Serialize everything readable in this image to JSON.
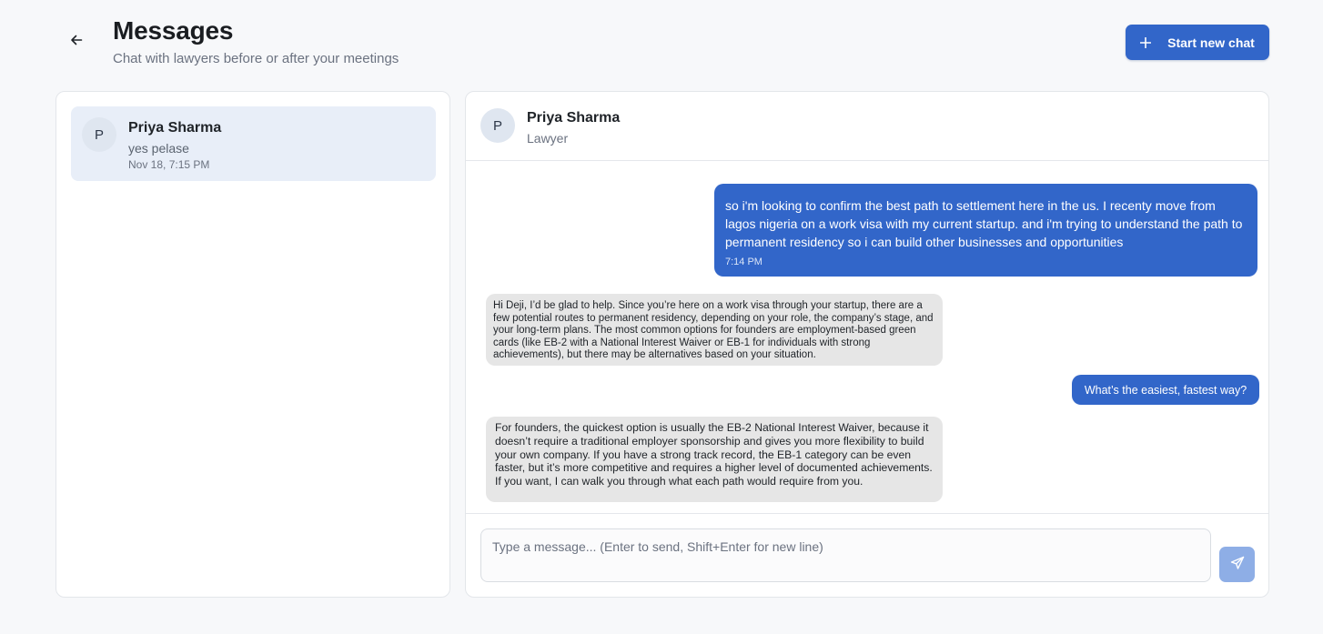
{
  "header": {
    "title": "Messages",
    "subtitle": "Chat with lawyers before or after your meetings",
    "back_icon": "arrow-left-icon",
    "new_chat_label": "Start new chat",
    "new_chat_icon": "plus-icon"
  },
  "conversations": [
    {
      "avatar_initial": "P",
      "name": "Priya Sharma",
      "preview": "yes pelase",
      "timestamp": "Nov 18, 7:15 PM",
      "selected": true
    }
  ],
  "chat": {
    "contact": {
      "avatar_initial": "P",
      "name": "Priya Sharma",
      "role": "Lawyer"
    },
    "messages": [
      {
        "direction": "outgoing",
        "text": "so i'm looking to confirm the best path to settlement here in the us. I recenty move from lagos nigeria on a work visa with my current startup.  and i'm trying to understand the path to permanent residency so i can build other businesses and opportunities",
        "time": "7:14 PM"
      },
      {
        "direction": "incoming",
        "text": "Hi Deji, I’d be glad to help. Since you’re here on a work visa through your startup, there are a few potential routes to permanent residency, depending on your role, the company’s stage, and your long-term plans. The most common options for founders are employment-based green cards (like EB-2 with a National Interest Waiver or EB-1 for individuals with strong achievements), but there may be alternatives based on your situation."
      },
      {
        "direction": "outgoing",
        "text": "What’s the easiest, fastest way?"
      },
      {
        "direction": "incoming",
        "text": "For founders, the quickest option is usually the EB-2 National Interest Waiver, because it doesn’t require a traditional employer sponsorship and gives you more flexibility to build your own company. If you have a strong track record, the EB-1 category can be even faster, but it’s more competitive and requires a higher level of documented achievements.\nIf you want, I can walk you through what each path would require from you."
      }
    ],
    "composer": {
      "placeholder": "Type a message... (Enter to send, Shift+Enter for new line)",
      "value": "",
      "send_icon": "send-icon"
    }
  },
  "colors": {
    "accent": "#3266c9",
    "selected_item_bg": "#e8eef8",
    "incoming_bubble_bg": "#e6e6e6",
    "send_button_disabled": "#8eaee6"
  }
}
